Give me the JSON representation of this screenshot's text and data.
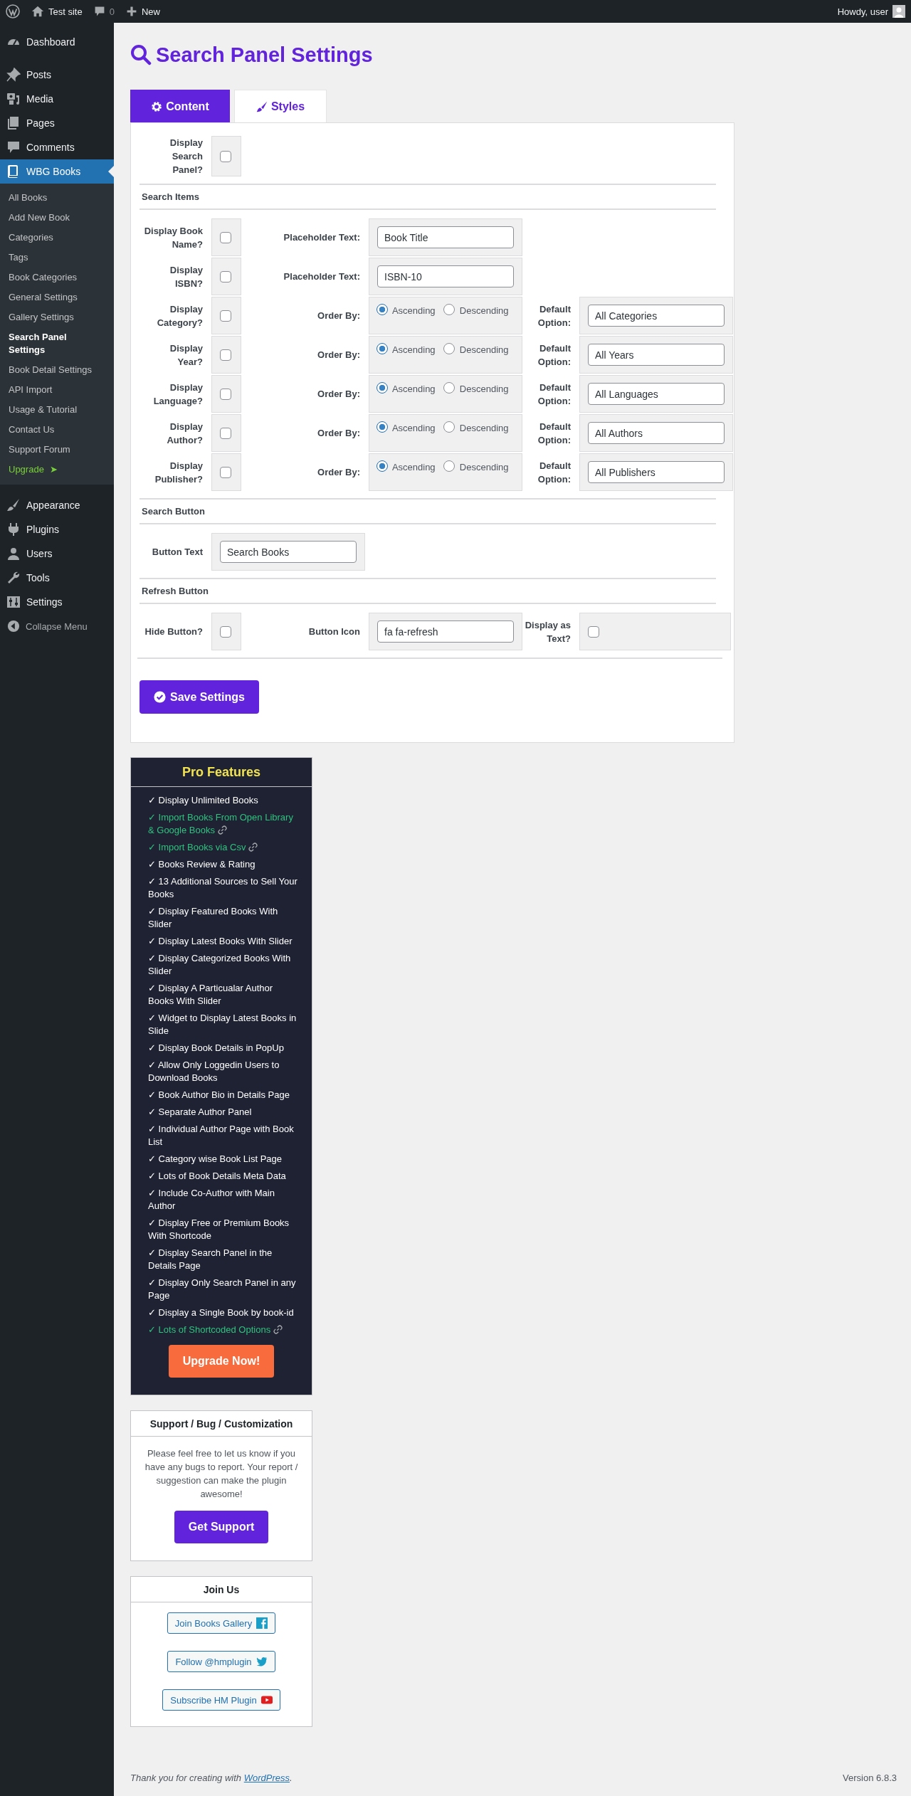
{
  "admin_bar": {
    "site": "Test site",
    "comments": "0",
    "new": "New",
    "greeting": "Howdy, user"
  },
  "sidebar": {
    "menu_groups": [
      {
        "items": [
          {
            "label": "Dashboard",
            "selected": false
          }
        ]
      },
      {
        "items": [
          {
            "label": "Posts",
            "selected": false
          },
          {
            "label": "Media",
            "selected": false
          },
          {
            "label": "Pages",
            "selected": false
          },
          {
            "label": "Comments",
            "selected": false
          },
          {
            "label": "WBG Books",
            "selected": true,
            "children": [
              {
                "label": "All Books",
                "selected": false,
                "kind": "link"
              },
              {
                "label": "Add New Book",
                "selected": false,
                "kind": "link"
              },
              {
                "label": "Categories",
                "selected": false,
                "kind": "link"
              },
              {
                "label": "Tags",
                "selected": false,
                "kind": "link"
              },
              {
                "label": "Book Categories",
                "selected": false,
                "kind": "link"
              },
              {
                "label": "General Settings",
                "selected": false,
                "kind": "link"
              },
              {
                "label": "Gallery Settings",
                "selected": false,
                "kind": "link"
              },
              {
                "label": "Search Panel Settings",
                "selected": true,
                "kind": "link"
              },
              {
                "label": "Book Detail Settings",
                "selected": false,
                "kind": "link"
              },
              {
                "label": "API Import",
                "selected": false,
                "kind": "link"
              },
              {
                "label": "Usage & Tutorial",
                "selected": false,
                "kind": "link"
              },
              {
                "label": "Contact Us",
                "selected": false,
                "kind": "link"
              },
              {
                "label": "Support Forum",
                "selected": false,
                "kind": "link"
              },
              {
                "label": "Upgrade",
                "selected": false,
                "kind": "upgrade",
                "arrow": "➤"
              }
            ]
          }
        ]
      },
      {
        "items": [
          {
            "label": "Appearance",
            "selected": false
          },
          {
            "label": "Plugins",
            "selected": false
          },
          {
            "label": "Users",
            "selected": false
          },
          {
            "label": "Tools",
            "selected": false
          },
          {
            "label": "Settings",
            "selected": false
          }
        ]
      }
    ],
    "collapse": "Collapse Menu"
  },
  "page_title": "Search Panel Settings",
  "tabs": [
    {
      "label": "Content",
      "selected": true
    },
    {
      "label": "Styles",
      "selected": false
    }
  ],
  "form": {
    "rows": [
      {
        "kind": "fields",
        "cells": [
          {
            "kind": "label",
            "text": "Display Search Panel?"
          },
          {
            "kind": "checkbox",
            "checked": false
          }
        ]
      },
      {
        "kind": "heading",
        "title": "Search Items"
      },
      {
        "kind": "fields",
        "cells": [
          {
            "kind": "label",
            "text": "Display Book Name?"
          },
          {
            "kind": "checkbox",
            "checked": false
          },
          {
            "kind": "label",
            "text": "Placeholder Text:"
          },
          {
            "kind": "text",
            "value": "Book Title"
          }
        ]
      },
      {
        "kind": "fields",
        "cells": [
          {
            "kind": "label",
            "text": "Display ISBN?"
          },
          {
            "kind": "checkbox",
            "checked": false
          },
          {
            "kind": "label",
            "text": "Placeholder Text:"
          },
          {
            "kind": "text",
            "value": "ISBN-10"
          }
        ]
      },
      {
        "kind": "fields",
        "cells": [
          {
            "kind": "label",
            "text": "Display Category?"
          },
          {
            "kind": "checkbox",
            "checked": false
          },
          {
            "kind": "label",
            "text": "Order By:"
          },
          {
            "kind": "radios",
            "options": [
              {
                "label": "Ascending",
                "selected": true
              },
              {
                "label": "Descending",
                "selected": false
              }
            ]
          },
          {
            "kind": "label",
            "text": "Default Option:"
          },
          {
            "kind": "text",
            "value": "All Categories"
          }
        ]
      },
      {
        "kind": "fields",
        "cells": [
          {
            "kind": "label",
            "text": "Display Year?"
          },
          {
            "kind": "checkbox",
            "checked": false
          },
          {
            "kind": "label",
            "text": "Order By:"
          },
          {
            "kind": "radios",
            "options": [
              {
                "label": "Ascending",
                "selected": true
              },
              {
                "label": "Descending",
                "selected": false
              }
            ]
          },
          {
            "kind": "label",
            "text": "Default Option:"
          },
          {
            "kind": "text",
            "value": "All Years"
          }
        ]
      },
      {
        "kind": "fields",
        "cells": [
          {
            "kind": "label",
            "text": "Display Language?"
          },
          {
            "kind": "checkbox",
            "checked": false
          },
          {
            "kind": "label",
            "text": "Order By:"
          },
          {
            "kind": "radios",
            "options": [
              {
                "label": "Ascending",
                "selected": true
              },
              {
                "label": "Descending",
                "selected": false
              }
            ]
          },
          {
            "kind": "label",
            "text": "Default Option:"
          },
          {
            "kind": "text",
            "value": "All Languages"
          }
        ]
      },
      {
        "kind": "fields",
        "cells": [
          {
            "kind": "label",
            "text": "Display Author?"
          },
          {
            "kind": "checkbox",
            "checked": false
          },
          {
            "kind": "label",
            "text": "Order By:"
          },
          {
            "kind": "radios",
            "options": [
              {
                "label": "Ascending",
                "selected": true
              },
              {
                "label": "Descending",
                "selected": false
              }
            ]
          },
          {
            "kind": "label",
            "text": "Default Option:"
          },
          {
            "kind": "text",
            "value": "All Authors"
          }
        ]
      },
      {
        "kind": "fields",
        "cells": [
          {
            "kind": "label",
            "text": "Display Publisher?"
          },
          {
            "kind": "checkbox",
            "checked": false
          },
          {
            "kind": "label",
            "text": "Order By:"
          },
          {
            "kind": "radios",
            "options": [
              {
                "label": "Ascending",
                "selected": true
              },
              {
                "label": "Descending",
                "selected": false
              }
            ]
          },
          {
            "kind": "label",
            "text": "Default Option:"
          },
          {
            "kind": "text",
            "value": "All Publishers"
          }
        ]
      },
      {
        "kind": "heading",
        "title": "Search Button"
      },
      {
        "kind": "fields",
        "cells": [
          {
            "kind": "label",
            "text": "Button Text"
          },
          {
            "kind": "text",
            "value": "Search Books"
          }
        ]
      },
      {
        "kind": "heading",
        "title": "Refresh Button"
      },
      {
        "kind": "fields",
        "cells": [
          {
            "kind": "label",
            "text": "Hide Button?"
          },
          {
            "kind": "checkbox",
            "checked": false
          },
          {
            "kind": "label",
            "text": "Button Icon"
          },
          {
            "kind": "text",
            "value": "fa fa-refresh"
          },
          {
            "kind": "label",
            "text": "Display as Text?"
          },
          {
            "kind": "checkbox",
            "checked": false
          }
        ]
      }
    ],
    "save_button": "Save Settings"
  },
  "pro_features": {
    "title": "Pro Features",
    "items": [
      {
        "text": "✓ Display Unlimited Books",
        "linked": false
      },
      {
        "text": "✓ Import Books From Open Library & Google Books",
        "linked": true
      },
      {
        "text": "✓ Import Books via Csv",
        "linked": true
      },
      {
        "text": "✓ Books Review & Rating",
        "linked": false
      },
      {
        "text": "✓ 13 Additional Sources to Sell Your Books",
        "linked": false
      },
      {
        "text": "✓ Display Featured Books With Slider",
        "linked": false
      },
      {
        "text": "✓ Display Latest Books With Slider",
        "linked": false
      },
      {
        "text": "✓ Display Categorized Books With Slider",
        "linked": false
      },
      {
        "text": "✓ Display A Particualar Author Books With Slider",
        "linked": false
      },
      {
        "text": "✓ Widget to Display Latest Books in Slide",
        "linked": false
      },
      {
        "text": "✓ Display Book Details in PopUp",
        "linked": false
      },
      {
        "text": "✓ Allow Only Loggedin Users to Download Books",
        "linked": false
      },
      {
        "text": "✓ Book Author Bio in Details Page",
        "linked": false
      },
      {
        "text": "✓ Separate Author Panel",
        "linked": false
      },
      {
        "text": "✓ Individual Author Page with Book List",
        "linked": false
      },
      {
        "text": "✓ Category wise Book List Page",
        "linked": false
      },
      {
        "text": "✓ Lots of Book Details Meta Data",
        "linked": false
      },
      {
        "text": "✓ Include Co-Author with Main Author",
        "linked": false
      },
      {
        "text": "✓ Display Free or Premium Books With Shortcode",
        "linked": false
      },
      {
        "text": "✓ Display Search Panel in the Details Page",
        "linked": false
      },
      {
        "text": "✓ Display Only Search Panel in any Page",
        "linked": false
      },
      {
        "text": "✓ Display a Single Book by book-id",
        "linked": false
      },
      {
        "text": "✓ Lots of Shortcoded Options",
        "linked": true
      }
    ],
    "button": "Upgrade Now!"
  },
  "support": {
    "title": "Support / Bug / Customization",
    "text": "Please feel free to let us know if you have any bugs to report. Your report / suggestion can make the plugin awesome!",
    "button": "Get Support"
  },
  "join": {
    "title": "Join Us",
    "buttons": [
      {
        "label": "Join Books Gallery"
      },
      {
        "label": "Follow @hmplugin"
      },
      {
        "label": "Subscribe HM Plugin"
      }
    ]
  },
  "footer": {
    "text_before": "Thank you for creating with",
    "link": "WordPress",
    "text_after": ".",
    "version": "Version 6.8.3"
  }
}
